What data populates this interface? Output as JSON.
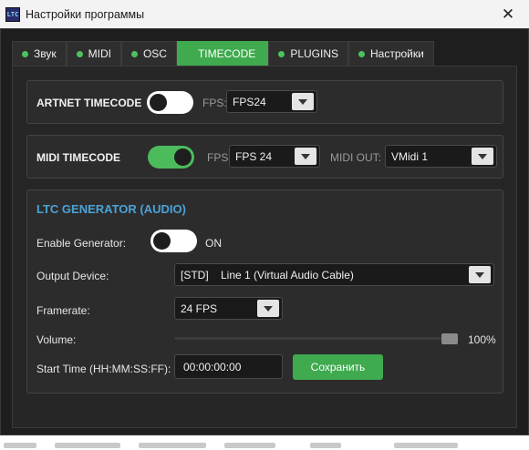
{
  "window": {
    "title": "Настройки программы",
    "app_icon_text": "LTC",
    "close_glyph": "✕"
  },
  "tabs": [
    {
      "label": "Звук",
      "active": false
    },
    {
      "label": "MIDI",
      "active": false
    },
    {
      "label": "OSC",
      "active": false
    },
    {
      "label": "TIMECODE",
      "active": true
    },
    {
      "label": "PLUGINS",
      "active": false
    },
    {
      "label": "Настройки",
      "active": false
    }
  ],
  "artnet": {
    "label": "ARTNET TIMECODE",
    "enabled": false,
    "fps_label": "FPS:",
    "fps_value": "FPS24"
  },
  "midi_tc": {
    "label": "MIDI TIMECODE",
    "enabled": true,
    "fps_label": "FPS:",
    "fps_value": "FPS 24",
    "out_label": "MIDI OUT:",
    "out_value": "VMidi 1"
  },
  "ltc": {
    "title": "LTC GENERATOR (AUDIO)",
    "enable_label": "Enable Generator:",
    "enabled": false,
    "state_text": "ON",
    "device_label": "Output Device:",
    "device_value": "[STD]    Line 1 (Virtual Audio Cable)",
    "framerate_label": "Framerate:",
    "framerate_value": "24 FPS",
    "volume_label": "Volume:",
    "volume_value": "100%",
    "volume_fraction": 1.0,
    "start_label": "Start Time (HH:MM:SS:FF):",
    "start_value": "00:00:00:00",
    "save_label": "Сохранить"
  },
  "colors": {
    "accent_green": "#3faa4e",
    "section_blue": "#4aa3d8",
    "background": "#1e1e1e"
  }
}
